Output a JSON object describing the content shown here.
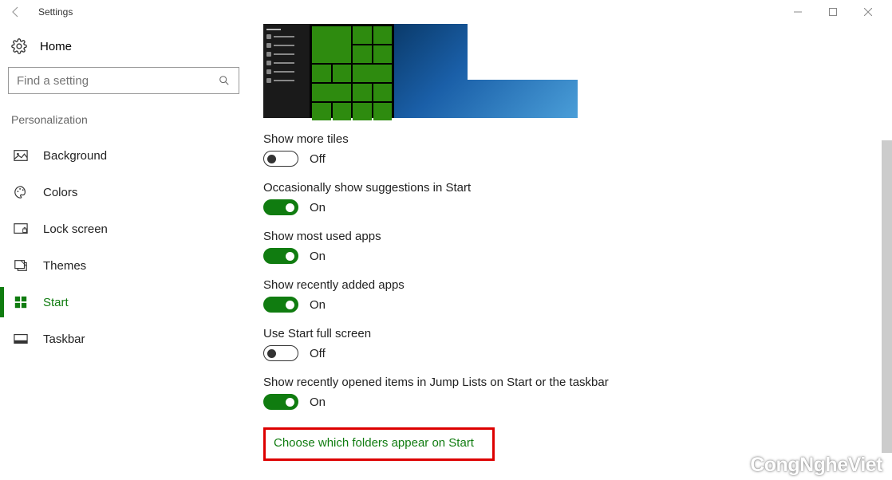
{
  "titlebar": {
    "title": "Settings"
  },
  "sidebar": {
    "home": "Home",
    "search_placeholder": "Find a setting",
    "category": "Personalization",
    "items": [
      {
        "label": "Background"
      },
      {
        "label": "Colors"
      },
      {
        "label": "Lock screen"
      },
      {
        "label": "Themes"
      },
      {
        "label": "Start"
      },
      {
        "label": "Taskbar"
      }
    ]
  },
  "settings": [
    {
      "label": "Show more tiles",
      "on": false,
      "state": "Off"
    },
    {
      "label": "Occasionally show suggestions in Start",
      "on": true,
      "state": "On"
    },
    {
      "label": "Show most used apps",
      "on": true,
      "state": "On"
    },
    {
      "label": "Show recently added apps",
      "on": true,
      "state": "On"
    },
    {
      "label": "Use Start full screen",
      "on": false,
      "state": "Off"
    },
    {
      "label": "Show recently opened items in Jump Lists on Start or the taskbar",
      "on": true,
      "state": "On"
    }
  ],
  "link": "Choose which folders appear on Start",
  "watermark": "CongNgheViet"
}
